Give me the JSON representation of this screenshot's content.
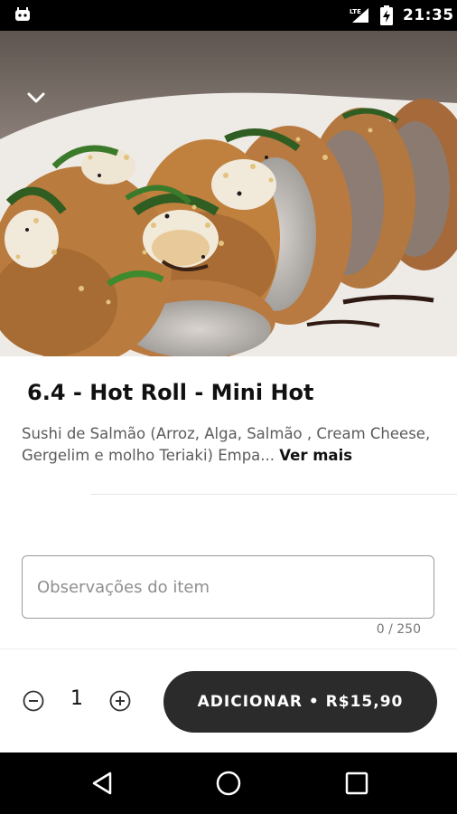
{
  "status_bar": {
    "time": "21:35",
    "network": "LTE",
    "left_icon": "android-notification-icon",
    "battery_icon": "battery-charging-icon"
  },
  "hero": {
    "image": "hot-roll-sushi-photo",
    "collapse_icon": "chevron-down-icon"
  },
  "product": {
    "title": "6.4 - Hot Roll - Mini Hot",
    "description": "Sushi de Salmão (Arroz, Alga, Salmão , Cream Cheese, Gergelim e molho Teriaki) Empa...",
    "see_more": "Ver mais"
  },
  "notes": {
    "placeholder": "Observações do item",
    "value": "",
    "counter": "0 / 250"
  },
  "order": {
    "quantity": "1",
    "minus_icon": "minus-circle-icon",
    "plus_icon": "plus-circle-icon",
    "add_label": "ADICIONAR • R$15,90"
  },
  "nav_bar": {
    "back_icon": "back-triangle-icon",
    "home_icon": "home-circle-icon",
    "recent_icon": "recent-square-icon"
  },
  "colors": {
    "button_bg": "#2b2b2b",
    "status_bg": "#000000",
    "text_primary": "#111111",
    "text_secondary": "#5b5b5b"
  }
}
